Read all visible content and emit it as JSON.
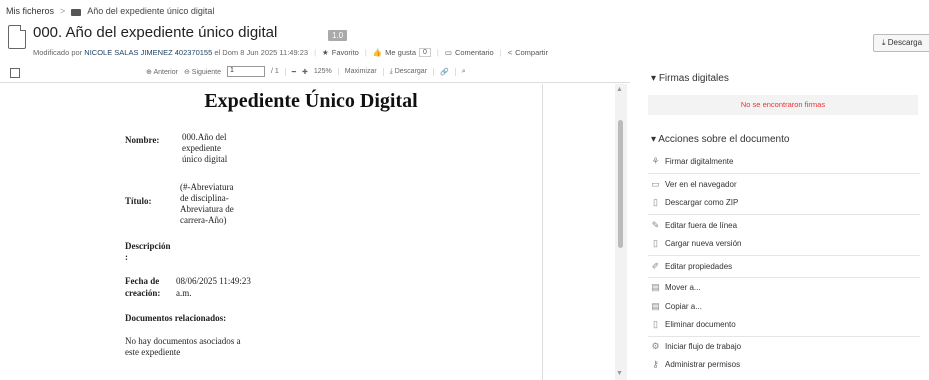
{
  "breadcrumb": {
    "root": "Mis ficheros",
    "separator": ">",
    "current": "Año del expediente único digital"
  },
  "doc": {
    "title": "000. Año del expediente único digital",
    "version": "1.0",
    "modified_prefix": "Modificado por",
    "modified_by": "NICOLE SALAS JIMENEZ 402370155",
    "modified_date": "el Dom 8 Jun 2025 11:49:23",
    "favorite": "Favorito",
    "like": "Me gusta",
    "like_count": "0",
    "comment": "Comentario",
    "share": "Compartir"
  },
  "download_top": "Descarga",
  "toolbar": {
    "prev": "Anterior",
    "next": "Siguiente",
    "page": "1",
    "page_total": "/ 1",
    "zoom": "125%",
    "maximize": "Maximizar",
    "download": "Descargar"
  },
  "content": {
    "title": "Expediente Único Digital",
    "nombre_label": "Nombre:",
    "nombre_value": [
      "000.Año del",
      "expediente",
      "único digital"
    ],
    "titulo_label": "Título:",
    "titulo_value": [
      "(#-Abreviatura",
      "de disciplina-",
      "Abreviatura de",
      "carrera-Año)"
    ],
    "descripcion_label": "Descripción",
    "descripcion_colon": ":",
    "fecha_label_1": "Fecha de",
    "fecha_label_2": "creación:",
    "fecha_value_1": "08/06/2025 11:49:23",
    "fecha_value_2": "a.m.",
    "docs_rel_label": "Documentos relacionados:",
    "docs_rel_value": [
      "No hay documentos asociados a",
      "este expediente"
    ]
  },
  "panel": {
    "firmas_title": "Firmas digitales",
    "no_firmas": "No se encontraron firmas",
    "acciones_title": "Acciones sobre el documento",
    "actions": [
      "Firmar digitalmente",
      "Ver en el navegador",
      "Descargar como ZIP",
      "Editar fuera de línea",
      "Cargar nueva versión",
      "Editar propiedades",
      "Mover a...",
      "Copiar a...",
      "Eliminar documento",
      "Iniciar flujo de trabajo",
      "Administrar permisos"
    ]
  },
  "colors": {
    "error": "#e33333",
    "link": "#224466"
  }
}
